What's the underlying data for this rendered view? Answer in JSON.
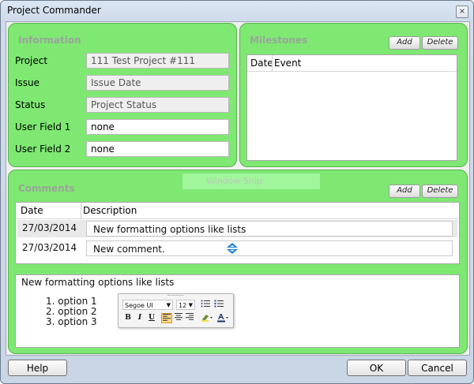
{
  "window": {
    "title": "Project Commander",
    "close_glyph": "×"
  },
  "information": {
    "title": "Information",
    "fields": [
      {
        "label": "Project",
        "value": "111 Test Project #111"
      },
      {
        "label": "Issue",
        "value": "Issue Date"
      },
      {
        "label": "Status",
        "value": "Project Status"
      },
      {
        "label": "User Field 1",
        "value": "none"
      },
      {
        "label": "User Field 2",
        "value": "none"
      }
    ]
  },
  "milestones": {
    "title": "Milestones",
    "add_label": "Add",
    "delete_label": "Delete",
    "columns": [
      "Date",
      "Event"
    ]
  },
  "comments": {
    "title": "Comments",
    "add_label": "Add",
    "delete_label": "Delete",
    "columns": [
      "Date",
      "Description"
    ],
    "rows": [
      {
        "date": "27/03/2014",
        "description": "New formatting options like lists"
      },
      {
        "date": "27/03/2014",
        "description": "New comment."
      }
    ]
  },
  "watermark": {
    "text": "Window Snip"
  },
  "editor": {
    "heading": "New formatting options like lists",
    "list": [
      "1.  option 1",
      "2.  option 2",
      "3.  option 3"
    ]
  },
  "format_toolbar": {
    "font_family": "Segoe UI",
    "font_size": "12",
    "bold": "B",
    "italic": "I",
    "underline": "U"
  },
  "footer": {
    "help_label": "Help",
    "ok_label": "OK",
    "cancel_label": "Cancel"
  }
}
